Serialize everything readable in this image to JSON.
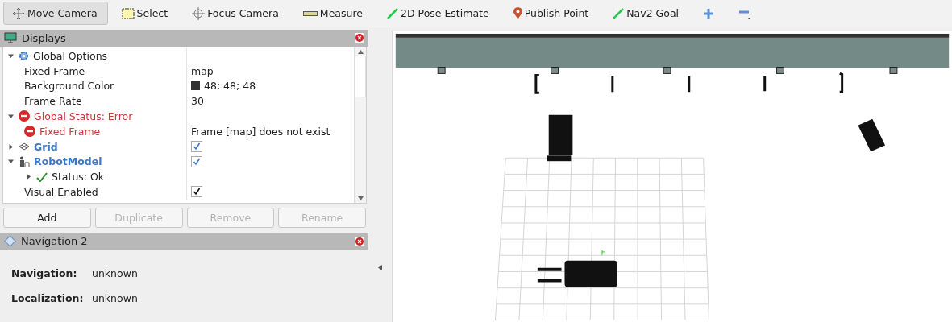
{
  "toolbar": {
    "tools": [
      {
        "label": "Move Camera",
        "kind": "move",
        "selected": true
      },
      {
        "label": "Select",
        "kind": "select",
        "selected": false
      },
      {
        "label": "Focus Camera",
        "kind": "focus",
        "selected": false
      },
      {
        "label": "Measure",
        "kind": "measure",
        "selected": false
      },
      {
        "label": "2D Pose Estimate",
        "kind": "pose",
        "selected": false
      },
      {
        "label": "Publish Point",
        "kind": "point",
        "selected": false
      },
      {
        "label": "Nav2 Goal",
        "kind": "pose",
        "selected": false
      },
      {
        "kind": "add",
        "selected": false
      },
      {
        "kind": "remove",
        "selected": false
      }
    ]
  },
  "displays": {
    "title": "Displays",
    "items": [
      {
        "label": "Global Options",
        "kind": "options",
        "expanded": true,
        "children": [
          {
            "label": "Fixed Frame",
            "value": "map",
            "kind": "property"
          },
          {
            "label": "Background Color",
            "value": "48; 48; 48",
            "kind": "color",
            "color": "#303030"
          },
          {
            "label": "Frame Rate",
            "value": "30",
            "kind": "property"
          }
        ]
      },
      {
        "label": "Global Status: Error",
        "kind": "error",
        "expanded": true,
        "children": [
          {
            "label": "Fixed Frame",
            "value": "Frame [map] does not exist",
            "kind": "error"
          }
        ]
      },
      {
        "label": "Grid",
        "kind": "grid",
        "expanded": false,
        "checked": true
      },
      {
        "label": "RobotModel",
        "kind": "robot",
        "expanded": true,
        "checked": true,
        "children": [
          {
            "label": "Status: Ok",
            "kind": "ok",
            "expanded": false
          },
          {
            "label": "Visual Enabled",
            "kind": "property",
            "checked": true
          }
        ]
      }
    ],
    "buttons": [
      {
        "label": "Add",
        "disabled": false
      },
      {
        "label": "Duplicate",
        "disabled": true
      },
      {
        "label": "Remove",
        "disabled": true
      },
      {
        "label": "Rename",
        "disabled": true
      }
    ]
  },
  "navigation": {
    "title": "Navigation 2",
    "fields": [
      {
        "label": "Navigation:",
        "value": "unknown"
      },
      {
        "label": "Localization:",
        "value": "unknown"
      }
    ]
  }
}
